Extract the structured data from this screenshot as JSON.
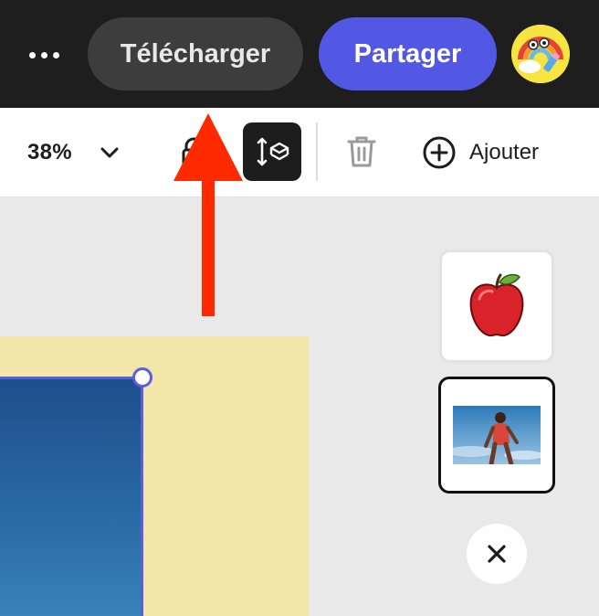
{
  "header": {
    "more_label": "…",
    "download_label": "Télécharger",
    "share_label": "Partager",
    "avatar_icon": "avatar-rainbow-icon"
  },
  "toolbar": {
    "zoom_value": "38%",
    "zoom_icon": "chevron-down-icon",
    "layer_icon": "layer-order-icon",
    "delete_icon": "trash-icon",
    "add_label": "Ajouter",
    "add_icon": "plus-circle-icon"
  },
  "side_panel": {
    "thumbnails": [
      {
        "name": "apple",
        "icon": "apple-image-icon",
        "selected": false
      },
      {
        "name": "runner-photo",
        "icon": "photo-thumbnail",
        "selected": true
      }
    ],
    "close_icon": "close-icon"
  },
  "annotation": {
    "arrow_color": "#ff2a00",
    "direction": "up"
  },
  "colors": {
    "top_bar": "#1e1e1e",
    "download_button": "#3d3d3d",
    "share_button": "#5258e4",
    "selection": "#5a5fe0",
    "artboard": "#f2e6a8",
    "canvas": "#e9e9e9"
  }
}
